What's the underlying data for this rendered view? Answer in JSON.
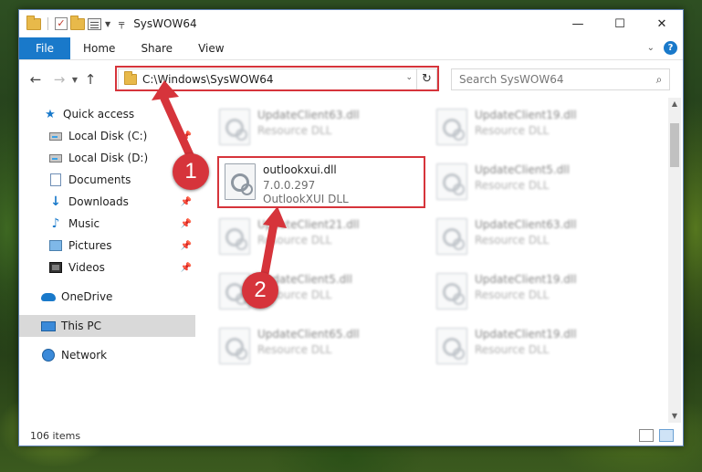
{
  "window": {
    "title": "SysWOW64",
    "controls": {
      "minimize": "—",
      "maximize": "☐",
      "close": "✕"
    }
  },
  "ribbon": {
    "tabs": [
      "File",
      "Home",
      "Share",
      "View"
    ],
    "help": "?"
  },
  "nav": {
    "address": "C:\\Windows\\SysWOW64",
    "search_placeholder": "Search SysWOW64"
  },
  "sidebar": {
    "items": [
      {
        "label": "Quick access",
        "icon": "star-icon"
      },
      {
        "label": "Local Disk (C:)",
        "icon": "drive-icon",
        "pinned": true
      },
      {
        "label": "Local Disk (D:)",
        "icon": "drive-icon",
        "pinned": false
      },
      {
        "label": "Documents",
        "icon": "documents-icon",
        "pinned": true
      },
      {
        "label": "Downloads",
        "icon": "download-icon",
        "pinned": true
      },
      {
        "label": "Music",
        "icon": "music-icon",
        "pinned": true
      },
      {
        "label": "Pictures",
        "icon": "pictures-icon",
        "pinned": true
      },
      {
        "label": "Videos",
        "icon": "videos-icon",
        "pinned": true
      },
      {
        "label": "OneDrive",
        "icon": "onedrive-icon"
      },
      {
        "label": "This PC",
        "icon": "this-pc-icon",
        "selected": true
      },
      {
        "label": "Network",
        "icon": "network-icon"
      }
    ]
  },
  "files": {
    "highlighted": {
      "name": "outlookxui.dll",
      "version": "7.0.0.297",
      "description": "OutlookXUI DLL"
    },
    "left_column": [
      {
        "name": "UpdateClient63.dll",
        "type": "Resource DLL"
      },
      {
        "name": "UpdateClient21.dll",
        "type": "Resource DLL"
      },
      {
        "name": "UpdateClient5.dll",
        "type": "Resource DLL"
      },
      {
        "name": "UpdateClient65.dll",
        "type": "Resource DLL"
      }
    ],
    "right_column": [
      {
        "name": "UpdateClient19.dll",
        "type": "Resource DLL"
      },
      {
        "name": "UpdateClient5.dll",
        "type": "Resource DLL"
      },
      {
        "name": "UpdateClient63.dll",
        "type": "Resource DLL"
      },
      {
        "name": "UpdateClient19.dll",
        "type": "Resource DLL"
      },
      {
        "name": "UpdateClient19.dll",
        "type": "Resource DLL"
      }
    ]
  },
  "status": {
    "item_count": "106 items"
  },
  "annotations": {
    "step1": "1",
    "step2": "2",
    "color": "#d6343b"
  }
}
